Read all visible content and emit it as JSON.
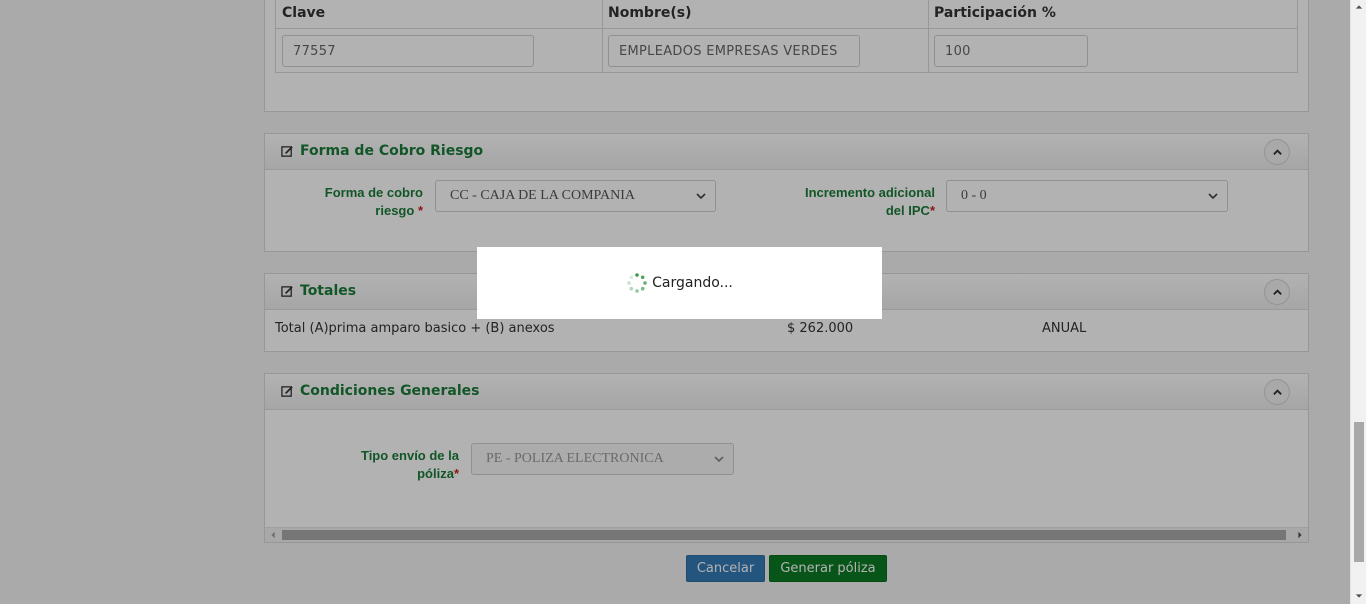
{
  "participantes": {
    "headers": [
      "Clave",
      "Nombre(s)",
      "Participación %"
    ],
    "clave": "77557",
    "nombre": "EMPLEADOS EMPRESAS VERDES",
    "participacion": "100"
  },
  "forma_cobro": {
    "title": "Forma de Cobro Riesgo",
    "label_forma_line1": "Forma de cobro",
    "label_forma_line2": "riesgo",
    "forma_value": "CC - CAJA DE LA COMPANIA",
    "label_incremento_line1": "Incremento adicional",
    "label_incremento_line2": "del IPC",
    "incremento_value": "0 - 0"
  },
  "totales": {
    "title": "Totales",
    "descripcion": "Total (A)prima amparo basico + (B) anexos",
    "monto": "$ 262.000",
    "periodicidad": "ANUAL"
  },
  "condiciones": {
    "title": "Condiciones Generales",
    "label_envio_line1": "Tipo envío de la",
    "label_envio_line2": "póliza",
    "envio_value": "PE - POLIZA ELECTRONICA"
  },
  "required_mark": "*",
  "actions": {
    "cancel": "Cancelar",
    "generate": "Generar póliza"
  },
  "loading": {
    "text": "Cargando..."
  },
  "colors": {
    "accent_green": "#1b7c3a",
    "cancel_blue": "#337ab7",
    "generate_green": "#0c7a24",
    "required_red": "#cc2020"
  }
}
